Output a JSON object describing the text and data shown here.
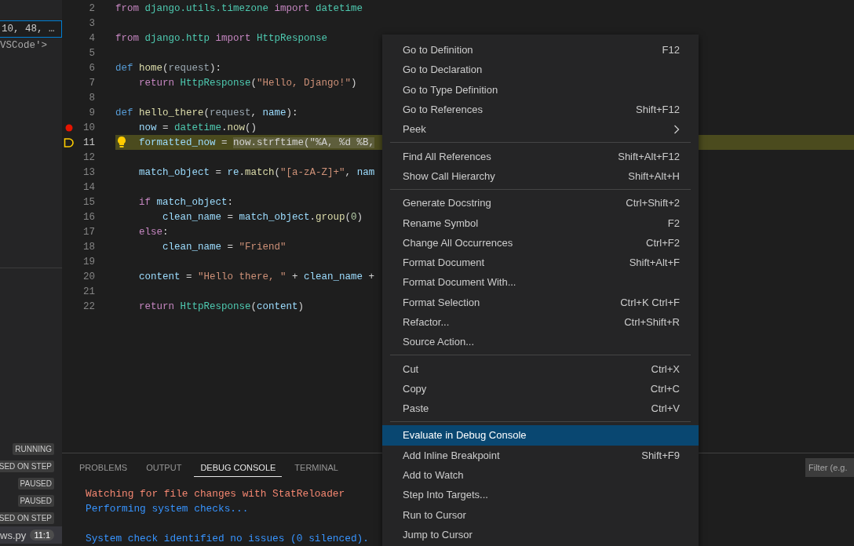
{
  "sidebar": {
    "watch_field": {
      "value": "10, 48, …"
    },
    "watch_text": "VSCode'>",
    "call_stack": [
      {
        "kind": "thread",
        "status": "RUNNING",
        "selected": false
      },
      {
        "kind": "thread",
        "status": "SED ON STEP",
        "selected": false
      },
      {
        "kind": "thread",
        "status": "PAUSED",
        "selected": false
      },
      {
        "kind": "thread",
        "status": "PAUSED",
        "selected": false
      },
      {
        "kind": "thread",
        "status": "SED ON STEP",
        "selected": false
      },
      {
        "kind": "frame",
        "file": "ws.py",
        "position": "11:1",
        "selected": true
      }
    ]
  },
  "editor": {
    "lines": [
      {
        "number": "2",
        "breakpoint": false,
        "current": false,
        "tokens": [
          {
            "t": "from ",
            "color": "#c586c0"
          },
          {
            "t": "django.utils.timezone ",
            "color": "#4ec9b0"
          },
          {
            "t": "import ",
            "color": "#c586c0"
          },
          {
            "t": "datetime",
            "color": "#4ec9b0"
          }
        ]
      },
      {
        "number": "3",
        "breakpoint": false,
        "current": false
      },
      {
        "number": "4",
        "breakpoint": false,
        "current": false,
        "tokens": [
          {
            "t": "from ",
            "color": "#c586c0"
          },
          {
            "t": "django.http ",
            "color": "#4ec9b0"
          },
          {
            "t": "import ",
            "color": "#c586c0"
          },
          {
            "t": "HttpResponse",
            "color": "#4ec9b0"
          }
        ]
      },
      {
        "number": "5",
        "breakpoint": false,
        "current": false
      },
      {
        "number": "6",
        "breakpoint": false,
        "current": false,
        "tokens": [
          {
            "t": "def ",
            "color": "#569cd6"
          },
          {
            "t": "home",
            "color": "#dcdcaa"
          },
          {
            "t": "("
          },
          {
            "t": "request",
            "color": "#9aa7b0"
          },
          {
            "t": "):"
          }
        ]
      },
      {
        "number": "7",
        "breakpoint": false,
        "current": false,
        "tokens": [
          {
            "t": "    return ",
            "color": "#c586c0"
          },
          {
            "t": "HttpResponse",
            "color": "#4ec9b0"
          },
          {
            "t": "("
          },
          {
            "t": "\"Hello, Django!\"",
            "color": "#ce9178"
          },
          {
            "t": ")"
          }
        ]
      },
      {
        "number": "8",
        "breakpoint": false,
        "current": false
      },
      {
        "number": "9",
        "breakpoint": false,
        "current": false,
        "tokens": [
          {
            "t": "def ",
            "color": "#569cd6"
          },
          {
            "t": "hello_there",
            "color": "#dcdcaa"
          },
          {
            "t": "("
          },
          {
            "t": "request",
            "color": "#9aa7b0"
          },
          {
            "t": ", "
          },
          {
            "t": "name",
            "color": "#9cdcfe"
          },
          {
            "t": "):"
          }
        ]
      },
      {
        "number": "10",
        "breakpoint": true,
        "current": false,
        "tokens": [
          {
            "t": "    now",
            "color": "#9cdcfe"
          },
          {
            "t": " = "
          },
          {
            "t": "datetime",
            "color": "#4ec9b0"
          },
          {
            "t": "."
          },
          {
            "t": "now",
            "color": "#dcdcaa"
          },
          {
            "t": "()"
          }
        ]
      },
      {
        "number": "11",
        "breakpoint": false,
        "current": true,
        "tokens": [
          {
            "t": "    formatted_now",
            "color": "#9cdcfe"
          },
          {
            "t": " = "
          }
        ],
        "selection": "now.strftime(\"%A, %d %B,"
      },
      {
        "number": "12",
        "breakpoint": false,
        "current": false
      },
      {
        "number": "13",
        "breakpoint": false,
        "current": false,
        "tokens": [
          {
            "t": "    match_object",
            "color": "#9cdcfe"
          },
          {
            "t": " = "
          },
          {
            "t": "re",
            "color": "#9cdcfe"
          },
          {
            "t": "."
          },
          {
            "t": "match",
            "color": "#dcdcaa"
          },
          {
            "t": "("
          },
          {
            "t": "\"[a-zA-Z]+\"",
            "color": "#ce9178"
          },
          {
            "t": ", "
          },
          {
            "t": "nam",
            "color": "#9cdcfe"
          }
        ]
      },
      {
        "number": "14",
        "breakpoint": false,
        "current": false
      },
      {
        "number": "15",
        "breakpoint": false,
        "current": false,
        "tokens": [
          {
            "t": "    if ",
            "color": "#c586c0"
          },
          {
            "t": "match_object",
            "color": "#9cdcfe"
          },
          {
            "t": ":"
          }
        ]
      },
      {
        "number": "16",
        "breakpoint": false,
        "current": false,
        "tokens": [
          {
            "t": "        clean_name",
            "color": "#9cdcfe"
          },
          {
            "t": " = "
          },
          {
            "t": "match_object",
            "color": "#9cdcfe"
          },
          {
            "t": "."
          },
          {
            "t": "group",
            "color": "#dcdcaa"
          },
          {
            "t": "("
          },
          {
            "t": "0",
            "color": "#b5cea8"
          },
          {
            "t": ")"
          }
        ]
      },
      {
        "number": "17",
        "breakpoint": false,
        "current": false,
        "tokens": [
          {
            "t": "    else",
            "color": "#c586c0"
          },
          {
            "t": ":"
          }
        ]
      },
      {
        "number": "18",
        "breakpoint": false,
        "current": false,
        "tokens": [
          {
            "t": "        clean_name",
            "color": "#9cdcfe"
          },
          {
            "t": " = "
          },
          {
            "t": "\"Friend\"",
            "color": "#ce9178"
          }
        ]
      },
      {
        "number": "19",
        "breakpoint": false,
        "current": false
      },
      {
        "number": "20",
        "breakpoint": false,
        "current": false,
        "tokens": [
          {
            "t": "    content",
            "color": "#9cdcfe"
          },
          {
            "t": " = "
          },
          {
            "t": "\"Hello there, \"",
            "color": "#ce9178"
          },
          {
            "t": " + "
          },
          {
            "t": "clean_name",
            "color": "#9cdcfe"
          },
          {
            "t": " +"
          }
        ]
      },
      {
        "number": "21",
        "breakpoint": false,
        "current": false
      },
      {
        "number": "22",
        "breakpoint": false,
        "current": false,
        "tokens": [
          {
            "t": "    return ",
            "color": "#c586c0"
          },
          {
            "t": "HttpResponse",
            "color": "#4ec9b0"
          },
          {
            "t": "("
          },
          {
            "t": "content",
            "color": "#9cdcfe"
          },
          {
            "t": ")"
          }
        ]
      }
    ]
  },
  "panel": {
    "tabs": [
      {
        "label": "PROBLEMS",
        "selected": false
      },
      {
        "label": "OUTPUT",
        "selected": false
      },
      {
        "label": "DEBUG CONSOLE",
        "selected": true
      },
      {
        "label": "TERMINAL",
        "selected": false
      }
    ],
    "filter": {
      "placeholder": "Filter (e.g."
    },
    "console": [
      [
        {
          "text": "Watching for file changes with StatReloader",
          "color": "#f48771"
        },
        {
          "text": "Performing system checks...",
          "color": "#3794ff"
        }
      ],
      [
        {
          "text": "System check identified no issues (0 silenced).",
          "color": "#3794ff"
        }
      ]
    ]
  },
  "context_menu": {
    "groups": [
      [
        {
          "label": "Go to Definition",
          "shortcut": "F12",
          "submenu": false,
          "selected": false
        },
        {
          "label": "Go to Declaration",
          "submenu": false,
          "selected": false
        },
        {
          "label": "Go to Type Definition",
          "submenu": false,
          "selected": false
        },
        {
          "label": "Go to References",
          "shortcut": "Shift+F12",
          "submenu": false,
          "selected": false
        },
        {
          "label": "Peek",
          "submenu": true,
          "selected": false
        }
      ],
      [
        {
          "label": "Find All References",
          "shortcut": "Shift+Alt+F12",
          "submenu": false,
          "selected": false
        },
        {
          "label": "Show Call Hierarchy",
          "shortcut": "Shift+Alt+H",
          "submenu": false,
          "selected": false
        }
      ],
      [
        {
          "label": "Generate Docstring",
          "shortcut": "Ctrl+Shift+2",
          "submenu": false,
          "selected": false
        },
        {
          "label": "Rename Symbol",
          "shortcut": "F2",
          "submenu": false,
          "selected": false
        },
        {
          "label": "Change All Occurrences",
          "shortcut": "Ctrl+F2",
          "submenu": false,
          "selected": false
        },
        {
          "label": "Format Document",
          "shortcut": "Shift+Alt+F",
          "submenu": false,
          "selected": false
        },
        {
          "label": "Format Document With...",
          "submenu": false,
          "selected": false
        },
        {
          "label": "Format Selection",
          "shortcut": "Ctrl+K Ctrl+F",
          "submenu": false,
          "selected": false
        },
        {
          "label": "Refactor...",
          "shortcut": "Ctrl+Shift+R",
          "submenu": false,
          "selected": false
        },
        {
          "label": "Source Action...",
          "submenu": false,
          "selected": false
        }
      ],
      [
        {
          "label": "Cut",
          "shortcut": "Ctrl+X",
          "submenu": false,
          "selected": false
        },
        {
          "label": "Copy",
          "shortcut": "Ctrl+C",
          "submenu": false,
          "selected": false
        },
        {
          "label": "Paste",
          "shortcut": "Ctrl+V",
          "submenu": false,
          "selected": false
        }
      ],
      [
        {
          "label": "Evaluate in Debug Console",
          "submenu": false,
          "selected": true
        },
        {
          "label": "Add Inline Breakpoint",
          "shortcut": "Shift+F9",
          "submenu": false,
          "selected": false
        },
        {
          "label": "Add to Watch",
          "submenu": false,
          "selected": false
        },
        {
          "label": "Step Into Targets...",
          "submenu": false,
          "selected": false
        },
        {
          "label": "Run to Cursor",
          "submenu": false,
          "selected": false
        },
        {
          "label": "Jump to Cursor",
          "submenu": false,
          "selected": false
        }
      ]
    ]
  }
}
